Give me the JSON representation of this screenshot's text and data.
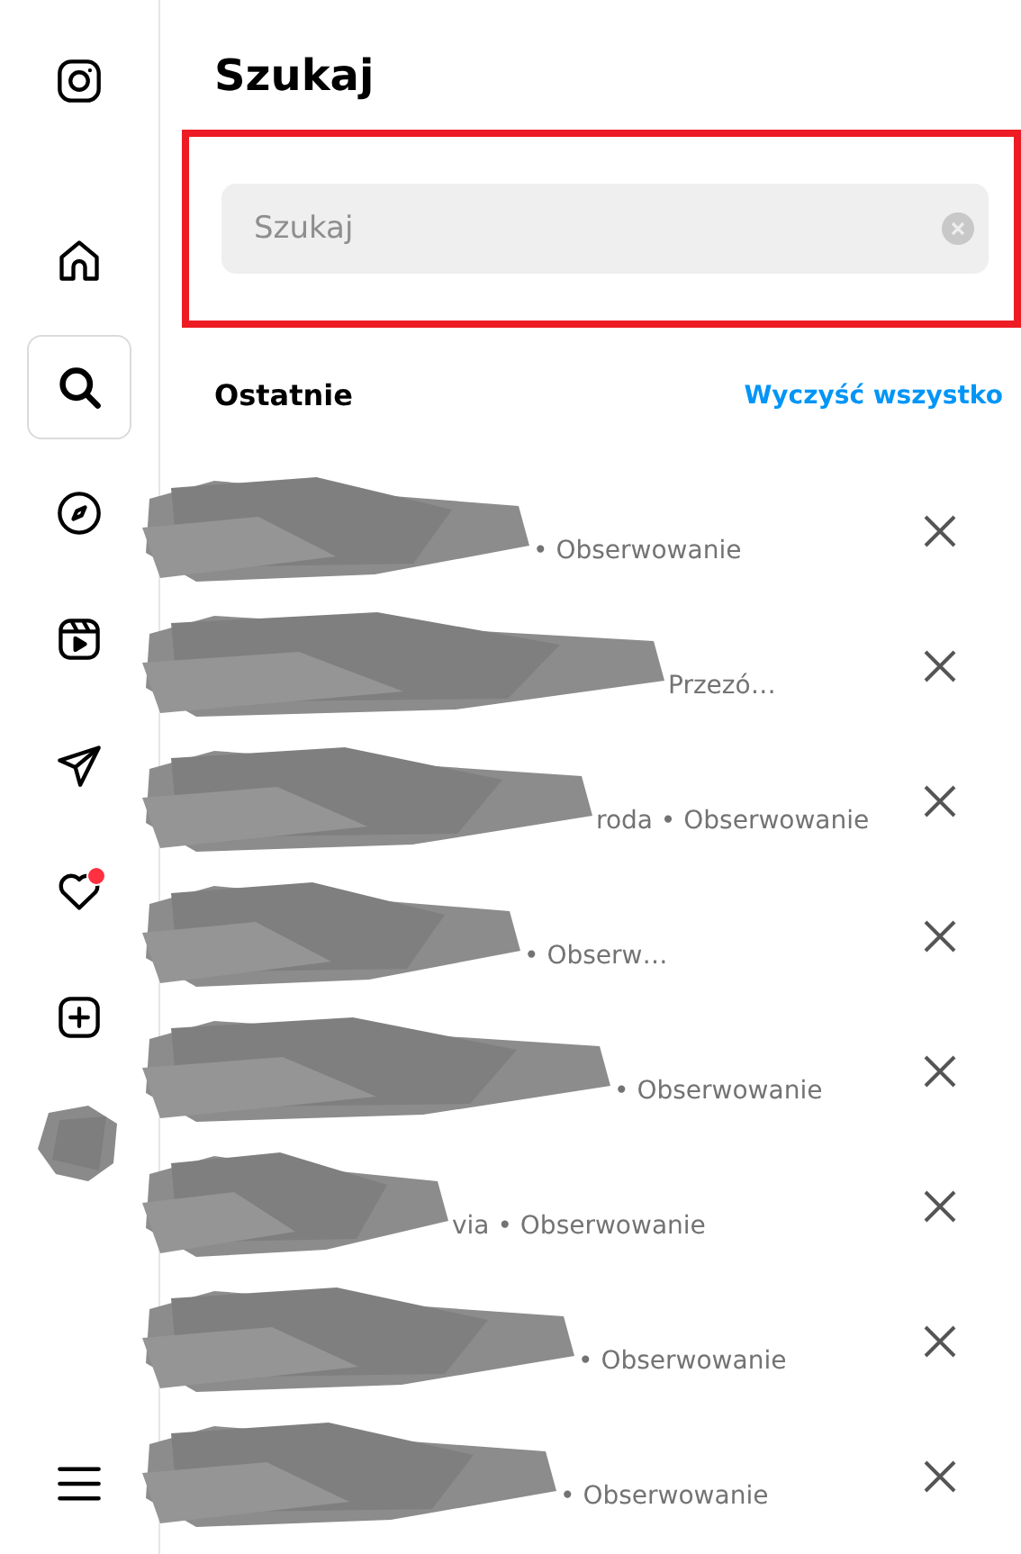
{
  "sidebar": {
    "items": [
      {
        "kind": "logo",
        "selected": false
      },
      {
        "kind": "home",
        "selected": false
      },
      {
        "kind": "search",
        "selected": true
      },
      {
        "kind": "explore",
        "selected": false
      },
      {
        "kind": "reels",
        "selected": false
      },
      {
        "kind": "messages",
        "selected": false
      },
      {
        "kind": "notifications",
        "selected": false,
        "badge": true
      },
      {
        "kind": "create",
        "selected": false
      },
      {
        "kind": "profile",
        "selected": false
      },
      {
        "kind": "menu",
        "selected": false
      }
    ]
  },
  "panel": {
    "title": "Szukaj",
    "search": {
      "placeholder": "Szukaj",
      "highlighted": true
    },
    "recent": {
      "heading": "Ostatnie",
      "clear_link": "Wyczyść wszystko",
      "items": [
        {
          "visible_text": "• Obserwowanie"
        },
        {
          "visible_text": "Przezó…"
        },
        {
          "visible_text": "roda • Obserwowanie"
        },
        {
          "visible_text": "• Obserw…"
        },
        {
          "visible_text": "• Obserwowanie"
        },
        {
          "visible_text": "via • Obserwowanie"
        },
        {
          "visible_text": "• Obserwowanie"
        },
        {
          "visible_text": "• Obserwowanie"
        }
      ]
    }
  }
}
